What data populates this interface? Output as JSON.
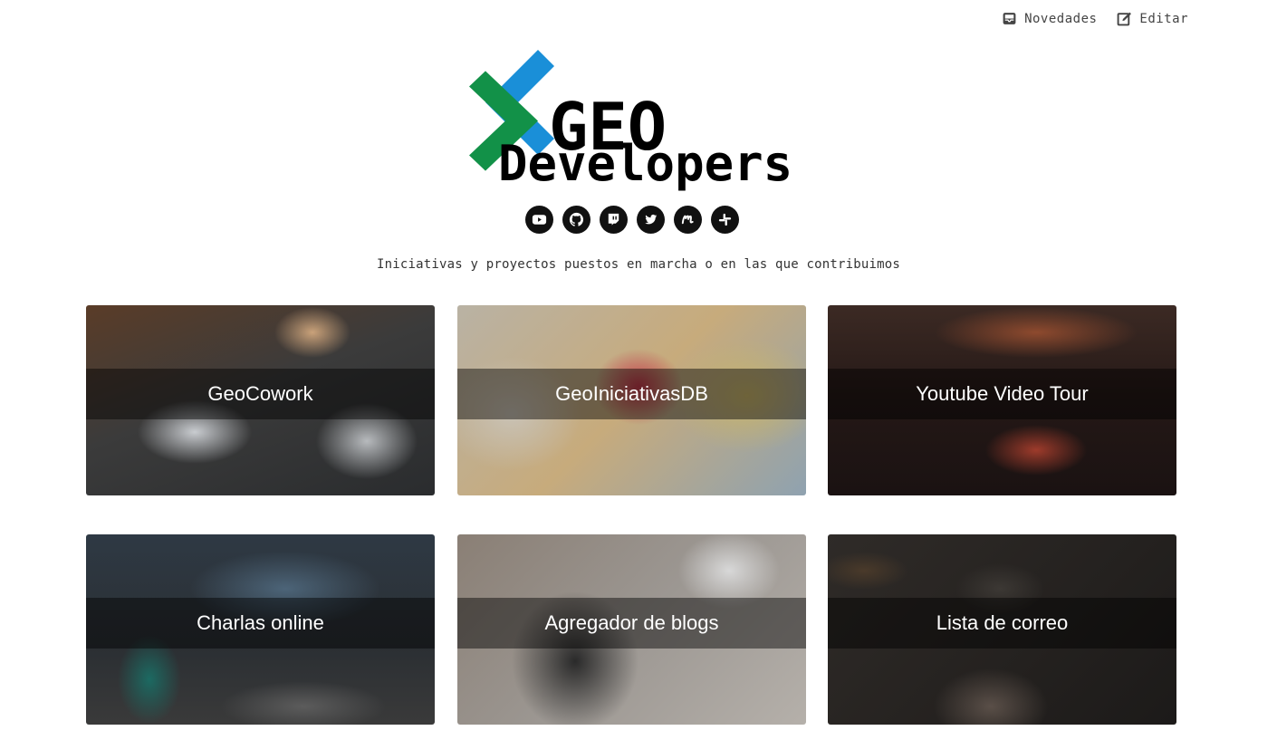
{
  "topnav": {
    "novedades_label": "Novedades",
    "editar_label": "Editar"
  },
  "logo": {
    "line1": "GEO",
    "line2": "Developers",
    "colors": {
      "blue": "#1a8fd8",
      "green": "#129148"
    }
  },
  "social": [
    {
      "icon": "youtube-icon"
    },
    {
      "icon": "github-icon"
    },
    {
      "icon": "twitch-icon"
    },
    {
      "icon": "twitter-icon"
    },
    {
      "icon": "meetup-icon"
    },
    {
      "icon": "slack-icon"
    }
  ],
  "tagline": "Iniciativas y proyectos puestos en marcha o en las que contribuimos",
  "cards": [
    {
      "title": "GeoCowork"
    },
    {
      "title": "GeoIniciativasDB"
    },
    {
      "title": "Youtube Video Tour"
    },
    {
      "title": "Charlas online"
    },
    {
      "title": "Agregador de blogs"
    },
    {
      "title": "Lista de correo"
    }
  ]
}
